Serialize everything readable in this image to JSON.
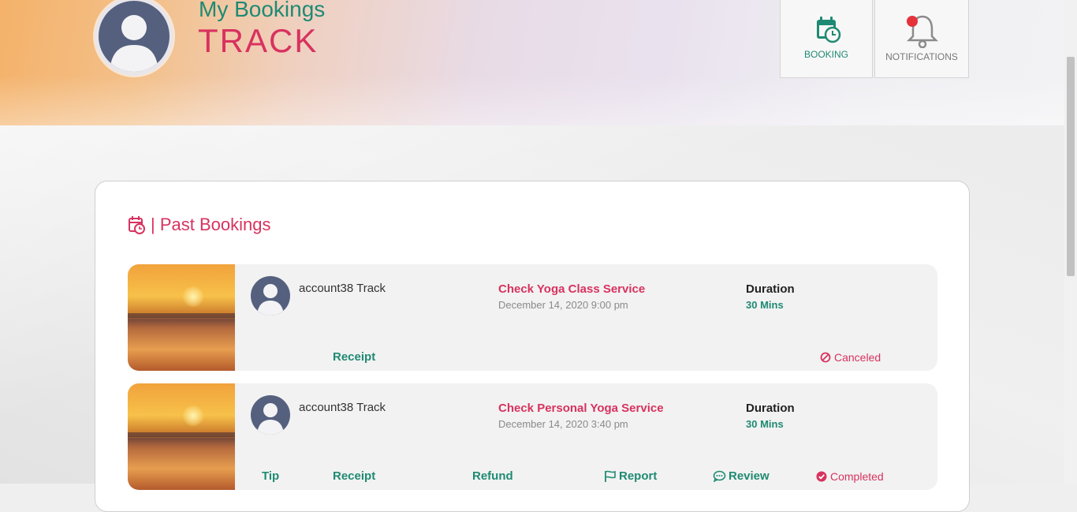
{
  "header": {
    "subtitle": "My Bookings",
    "username": "TRACK",
    "booking_label": "BOOKING",
    "notifications_label": "NOTIFICATIONS"
  },
  "section": {
    "title": "| Past Bookings"
  },
  "bookings": [
    {
      "user": "account38 Track",
      "service": "Check Yoga Class Service",
      "date": "December 14, 2020 9:00 pm",
      "duration_label": "Duration",
      "duration_value": "30 Mins",
      "actions": {
        "receipt": "Receipt"
      },
      "status": "Canceled"
    },
    {
      "user": "account38 Track",
      "service": "Check Personal Yoga Service",
      "date": "December 14, 2020 3:40 pm",
      "duration_label": "Duration",
      "duration_value": "30 Mins",
      "actions": {
        "tip": "Tip",
        "receipt": "Receipt",
        "refund": "Refund",
        "report": "Report",
        "review": "Review"
      },
      "status": "Completed"
    }
  ],
  "colors": {
    "accent_green": "#1f8a73",
    "accent_pink": "#d8325f",
    "avatar": "#55607f",
    "notification_dot": "#e5323b"
  },
  "icons": [
    "calendar-clock-icon",
    "bell-icon",
    "ban-icon",
    "check-circle-icon",
    "flag-icon",
    "comment-icon"
  ]
}
